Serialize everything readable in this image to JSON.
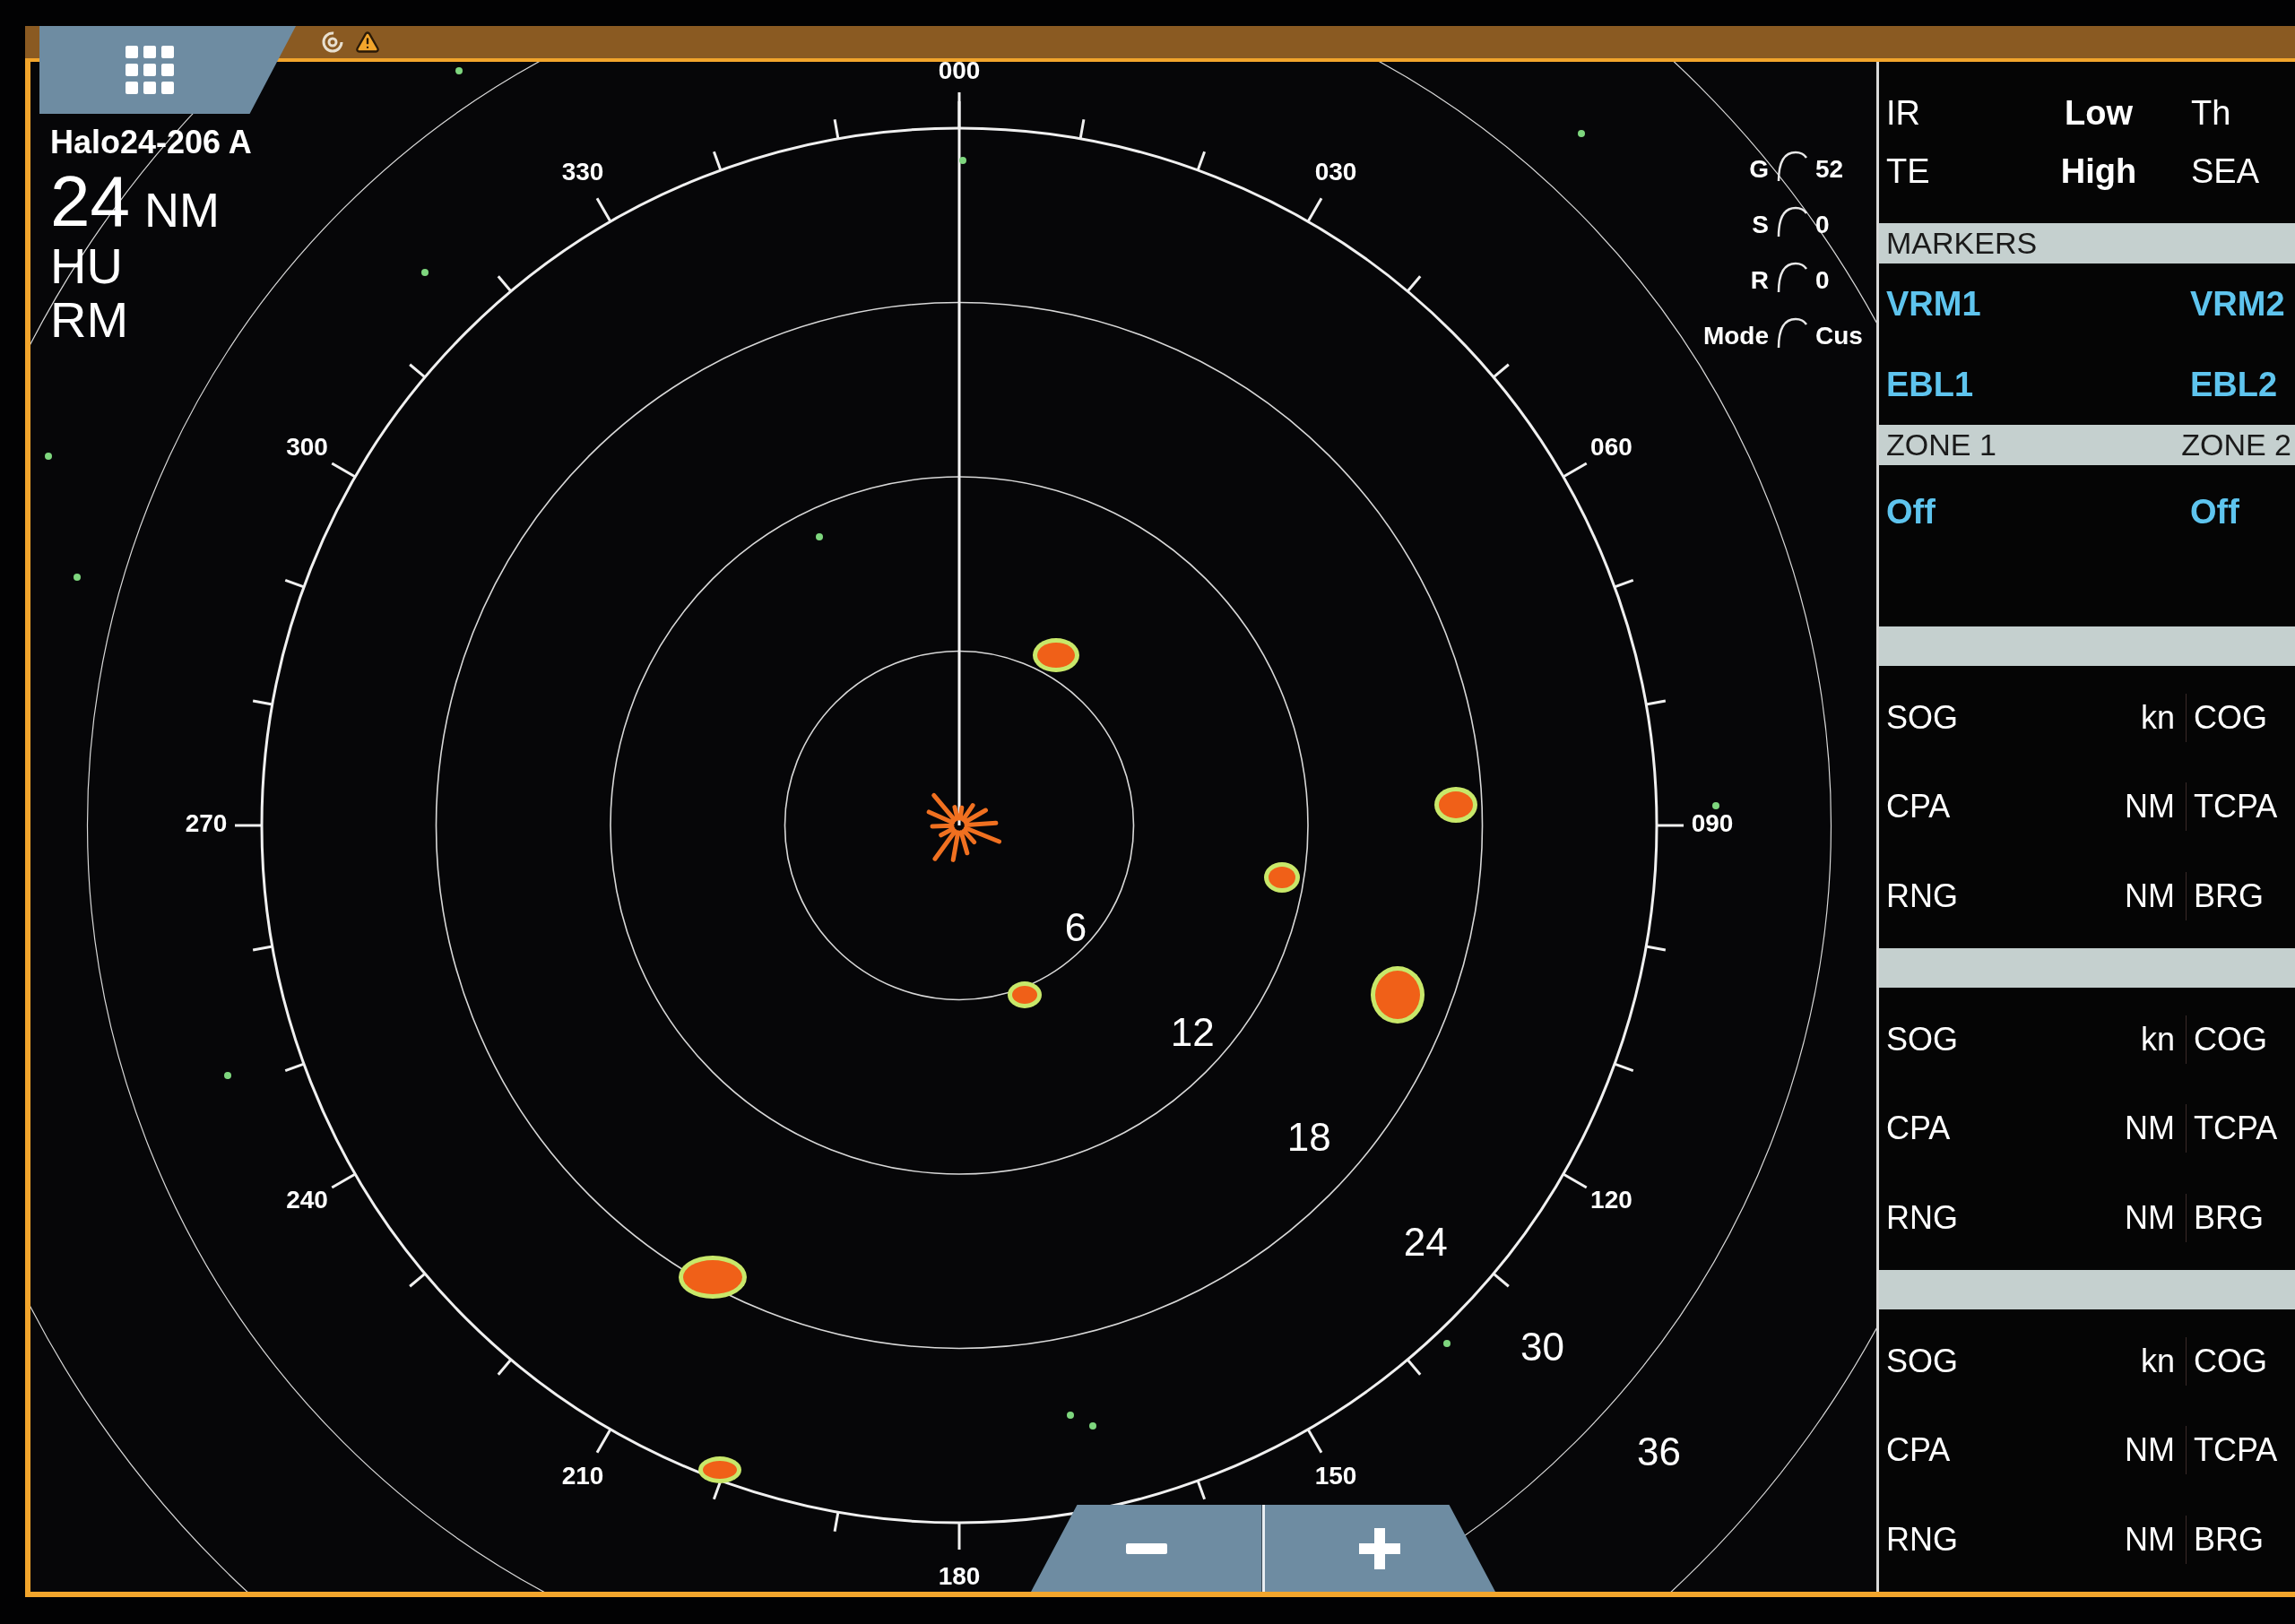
{
  "radar_info": {
    "radar_name": "Halo24-206 A",
    "range_value": "24",
    "range_unit": "NM",
    "orientation": "HU",
    "motion": "RM"
  },
  "radar_controls": [
    {
      "label": "G",
      "value": "52"
    },
    {
      "label": "S",
      "value": "0"
    },
    {
      "label": "R",
      "value": "0"
    },
    {
      "label": "Mode",
      "value": "Cus"
    }
  ],
  "bearing_labels": [
    "000",
    "030",
    "060",
    "090",
    "120",
    "150",
    "180",
    "210",
    "240",
    "270",
    "300",
    "330"
  ],
  "range_labels": [
    "6",
    "12",
    "18",
    "24",
    "30",
    "36"
  ],
  "settings_panel": {
    "rows": [
      [
        "IR",
        "Low",
        "Th"
      ],
      [
        "TE",
        "High",
        "SEA"
      ]
    ]
  },
  "markers": {
    "header": "MARKERS",
    "vrm": [
      "VRM1",
      "VRM2"
    ],
    "ebl": [
      "EBL1",
      "EBL2"
    ]
  },
  "zones": {
    "headers": [
      "ZONE 1",
      "ZONE 2"
    ],
    "values": [
      "Off",
      "Off"
    ]
  },
  "targets": [
    {
      "rows": [
        {
          "label": "SOG",
          "unit": "kn",
          "label_2": "COG"
        },
        {
          "label": "CPA",
          "unit": "NM",
          "label_2": "TCPA"
        },
        {
          "label": "RNG",
          "unit": "NM",
          "label_2": "BRG"
        }
      ]
    },
    {
      "rows": [
        {
          "label": "SOG",
          "unit": "kn",
          "label_2": "COG"
        },
        {
          "label": "CPA",
          "unit": "NM",
          "label_2": "TCPA"
        },
        {
          "label": "RNG",
          "unit": "NM",
          "label_2": "BRG"
        }
      ]
    },
    {
      "rows": [
        {
          "label": "SOG",
          "unit": "kn",
          "label_2": "COG"
        },
        {
          "label": "CPA",
          "unit": "NM",
          "label_2": "TCPA"
        },
        {
          "label": "RNG",
          "unit": "NM",
          "label_2": "BRG"
        }
      ]
    }
  ]
}
